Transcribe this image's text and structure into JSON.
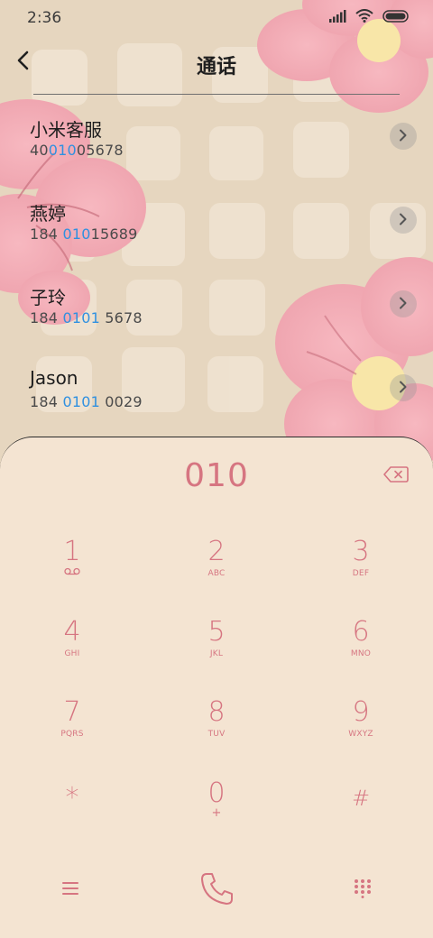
{
  "status_bar": {
    "time": "2:36"
  },
  "header": {
    "title": "通话"
  },
  "contacts": [
    {
      "name": "小米客服",
      "number_pre": "40",
      "number_hl": "010",
      "number_post": "05678"
    },
    {
      "name": "燕婷",
      "number_pre": "184 ",
      "number_hl": "010",
      "number_post": "15689"
    },
    {
      "name": "子玲",
      "number_pre": "184 ",
      "number_hl": "0101",
      "number_post": " 5678"
    },
    {
      "name": "Jason",
      "number_pre": "184 ",
      "number_hl": "0101",
      "number_post": " 0029"
    }
  ],
  "dialer": {
    "display": "010",
    "keys": [
      {
        "digit": "1",
        "letters": ""
      },
      {
        "digit": "2",
        "letters": "ABC"
      },
      {
        "digit": "3",
        "letters": "DEF"
      },
      {
        "digit": "4",
        "letters": "GHI"
      },
      {
        "digit": "5",
        "letters": "JKL"
      },
      {
        "digit": "6",
        "letters": "MNO"
      },
      {
        "digit": "7",
        "letters": "PQRS"
      },
      {
        "digit": "8",
        "letters": "TUV"
      },
      {
        "digit": "9",
        "letters": "WXYZ"
      },
      {
        "digit": "*",
        "letters": ""
      },
      {
        "digit": "0",
        "letters": "+"
      },
      {
        "digit": "#",
        "letters": ""
      }
    ]
  },
  "colors": {
    "accent": "#d67581",
    "highlight": "#2f90e0",
    "sheet_bg": "#f4e4d2",
    "wallpaper_bg": "#e6d6bf"
  }
}
